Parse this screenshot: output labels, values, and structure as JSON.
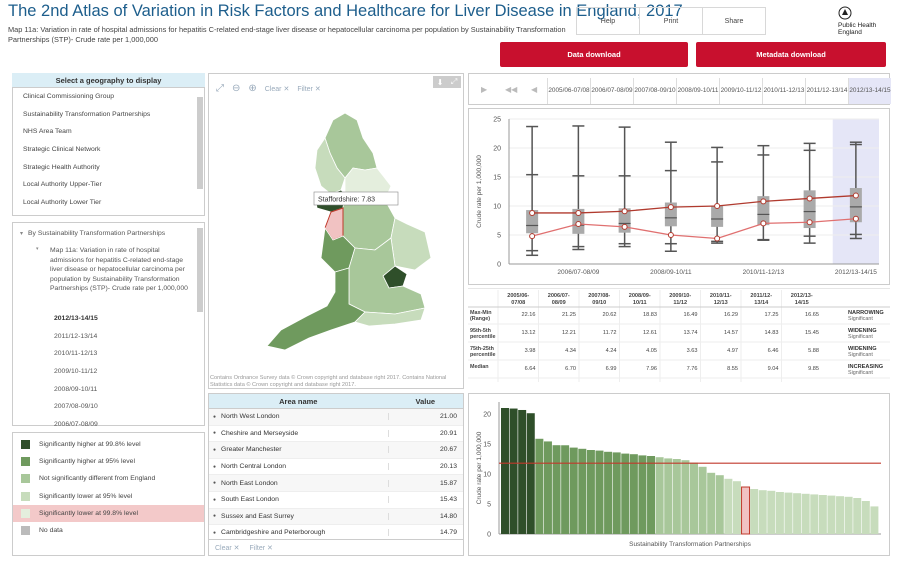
{
  "header": {
    "title": "The 2nd Atlas of Variation in Risk Factors and Healthcare for Liver Disease in England, 2017",
    "subtitle": "Map 11a: Variation in rate of hospital admissions for hepatitis C-related end-stage liver disease or hepatocellular carcinoma per population by Sustainability Transformation Partnerships (STP)- Crude rate per 1,000,000",
    "buttons": {
      "help": "Help",
      "print": "Print",
      "share": "Share"
    },
    "logo": "Public Health England",
    "data_download": "Data download",
    "metadata_download": "Metadata download"
  },
  "geography": {
    "heading": "Select a geography to display",
    "items": [
      "Clinical Commissioning Group",
      "Sustainability Transformation Partnerships",
      "NHS Area Team",
      "Strategic Clinical Network",
      "Strategic Health Authority",
      "Local Authority Upper-Tier",
      "Local Authority Lower Tier"
    ]
  },
  "tree": {
    "group": "By Sustainability Transformation Partnerships",
    "map_label": "Map 11a: Variation in rate of hospital admissions for hepatitis C-related end-stage liver disease or hepatocellular carcinoma per population by Sustainability Transformation Partnerships (STP)- Crude rate per 1,000,000",
    "periods": [
      "2012/13-14/15",
      "2011/12-13/14",
      "2010/11-12/13",
      "2009/10-11/12",
      "2008/09-10/11",
      "2007/08-09/10",
      "2006/07-08/09"
    ],
    "selected": "2012/13-14/15"
  },
  "legend": [
    {
      "label": "Significantly higher at 99.8% level",
      "color": "#2f4f2a"
    },
    {
      "label": "Significantly higher at 95% level",
      "color": "#6f9a5e"
    },
    {
      "label": "Not significantly different from England",
      "color": "#a8c79a"
    },
    {
      "label": "Significantly lower at 95% level",
      "color": "#c7dcbc"
    },
    {
      "label": "Significantly lower at 99.8% level",
      "color": "#e4eedd",
      "highlight": true
    },
    {
      "label": "No data",
      "color": "#bbbbbb"
    }
  ],
  "map": {
    "tools": {
      "clear": "Clear",
      "filter": "Filter"
    },
    "tooltip": "Staffordshire: 7.83",
    "copyright": "Contains Ordnance Survey data © Crown copyright and database right 2017. Contains National Statistics data © Crown copyright and database right 2017."
  },
  "table": {
    "col_name": "Area name",
    "col_value": "Value",
    "rows": [
      {
        "name": "North West London",
        "value": "21.00"
      },
      {
        "name": "Cheshire and Merseyside",
        "value": "20.91"
      },
      {
        "name": "Greater Manchester",
        "value": "20.67"
      },
      {
        "name": "North Central London",
        "value": "20.13"
      },
      {
        "name": "North East London",
        "value": "15.87"
      },
      {
        "name": "South East London",
        "value": "15.43"
      },
      {
        "name": "Sussex and East Surrey",
        "value": "14.80"
      },
      {
        "name": "Cambridgeshire and Peterborough",
        "value": "14.79"
      }
    ],
    "footer": {
      "clear": "Clear",
      "filter": "Filter"
    }
  },
  "periods": [
    "2005/06-07/08",
    "2006/07-08/09",
    "2007/08-09/10",
    "2008/09-10/11",
    "2009/10-11/12",
    "2010/11-12/13",
    "2011/12-13/14",
    "2012/13-14/15"
  ],
  "selected_period_index": 7,
  "colors": {
    "title": "#1d5e8c",
    "accent_red": "#c8102e",
    "header_blue": "#dbeef6",
    "england_line": "#c0392b",
    "highlight": "#e5e6f7"
  },
  "stats_table": {
    "headers": [
      "2005/06-07/08",
      "2006/07-08/09",
      "2007/08-09/10",
      "2008/09-10/11",
      "2009/10-11/12",
      "2010/11-12/13",
      "2011/12-13/14",
      "2012/13-14/15"
    ],
    "rows": [
      {
        "label": "Max-Min (Range)",
        "values": [
          "22.16",
          "21.25",
          "20.62",
          "18.83",
          "16.49",
          "16.29",
          "17.25",
          "16.65"
        ],
        "trend": "NARROWING",
        "sig": "Significant"
      },
      {
        "label": "95th-5th percentile",
        "values": [
          "13.12",
          "12.21",
          "11.72",
          "12.61",
          "13.74",
          "14.57",
          "14.83",
          "15.45"
        ],
        "trend": "WIDENING",
        "sig": "Significant"
      },
      {
        "label": "75th-25th percentile",
        "values": [
          "3.98",
          "4.34",
          "4.24",
          "4.05",
          "3.63",
          "4.97",
          "6.46",
          "5.88"
        ],
        "trend": "WIDENING",
        "sig": "Significant"
      },
      {
        "label": "Median",
        "values": [
          "6.64",
          "6.70",
          "6.99",
          "7.96",
          "7.76",
          "8.55",
          "9.04",
          "9.85"
        ],
        "trend": "INCREASING",
        "sig": "Significant"
      }
    ]
  },
  "chart_data": [
    {
      "type": "box",
      "ylabel": "Crude rate per 1,000,000",
      "ylim": [
        0,
        25
      ],
      "yticks": [
        0,
        5,
        10,
        15,
        20,
        25
      ],
      "categories": [
        "2005/06-07/08",
        "2006/07-08/09",
        "2007/08-09/10",
        "2008/09-10/11",
        "2009/10-11/12",
        "2010/11-12/13",
        "2011/12-13/14",
        "2012/13-14/15"
      ],
      "xtick_labels": [
        "2006/07-08/09",
        "2008/09-10/11",
        "2010/11-12/13",
        "2012/13-14/15"
      ],
      "boxes": [
        {
          "min": 1.5,
          "p5": 2.3,
          "q1": 5.3,
          "median": 6.64,
          "q3": 9.3,
          "p95": 15.4,
          "max": 23.7
        },
        {
          "min": 2.5,
          "p5": 3.0,
          "q1": 5.2,
          "median": 6.7,
          "q3": 9.5,
          "p95": 15.2,
          "max": 23.8
        },
        {
          "min": 3.0,
          "p5": 3.5,
          "q1": 5.4,
          "median": 6.99,
          "q3": 9.6,
          "p95": 15.2,
          "max": 23.6
        },
        {
          "min": 2.2,
          "p5": 3.5,
          "q1": 6.5,
          "median": 7.96,
          "q3": 10.6,
          "p95": 16.1,
          "max": 21.0
        },
        {
          "min": 3.6,
          "p5": 3.9,
          "q1": 6.4,
          "median": 7.76,
          "q3": 10.0,
          "p95": 17.6,
          "max": 20.1
        },
        {
          "min": 4.1,
          "p5": 4.2,
          "q1": 6.7,
          "median": 8.55,
          "q3": 11.7,
          "p95": 18.8,
          "max": 20.4
        },
        {
          "min": 3.6,
          "p5": 4.8,
          "q1": 6.2,
          "median": 9.04,
          "q3": 12.7,
          "p95": 19.6,
          "max": 20.8
        },
        {
          "min": 4.4,
          "p5": 5.1,
          "q1": 7.2,
          "median": 9.85,
          "q3": 13.1,
          "p95": 20.6,
          "max": 21.0
        }
      ],
      "series": [
        {
          "values": [
            8.8,
            8.8,
            9.1,
            9.8,
            10.0,
            10.8,
            11.3,
            11.8
          ]
        },
        {
          "values": [
            4.8,
            6.9,
            6.4,
            5.0,
            4.4,
            7.0,
            7.2,
            7.8
          ]
        }
      ]
    },
    {
      "type": "bar",
      "ylabel": "Crude rate per 1,000,000",
      "xlabel": "Sustainability Transformation Partnerships",
      "ylim": [
        0,
        22
      ],
      "yticks": [
        0,
        5,
        10,
        15,
        20
      ],
      "reference_line": 11.8,
      "highlight_index": 28,
      "values": [
        21.0,
        20.91,
        20.67,
        20.13,
        15.87,
        15.43,
        14.8,
        14.79,
        14.4,
        14.2,
        14.0,
        13.9,
        13.7,
        13.6,
        13.4,
        13.3,
        13.1,
        13.0,
        12.8,
        12.6,
        12.5,
        12.3,
        11.9,
        11.2,
        10.2,
        9.8,
        9.2,
        8.8,
        7.83,
        7.5,
        7.3,
        7.2,
        7.0,
        6.9,
        6.8,
        6.7,
        6.6,
        6.5,
        6.4,
        6.3,
        6.2,
        6.0,
        5.5,
        4.6
      ],
      "categories_levels": [
        0,
        0,
        0,
        0,
        1,
        1,
        1,
        1,
        1,
        1,
        1,
        1,
        1,
        1,
        1,
        1,
        1,
        1,
        2,
        2,
        2,
        2,
        2,
        2,
        2,
        2,
        3,
        3,
        4,
        3,
        3,
        3,
        3,
        3,
        3,
        3,
        3,
        3,
        3,
        3,
        3,
        3,
        3,
        3
      ]
    }
  ]
}
